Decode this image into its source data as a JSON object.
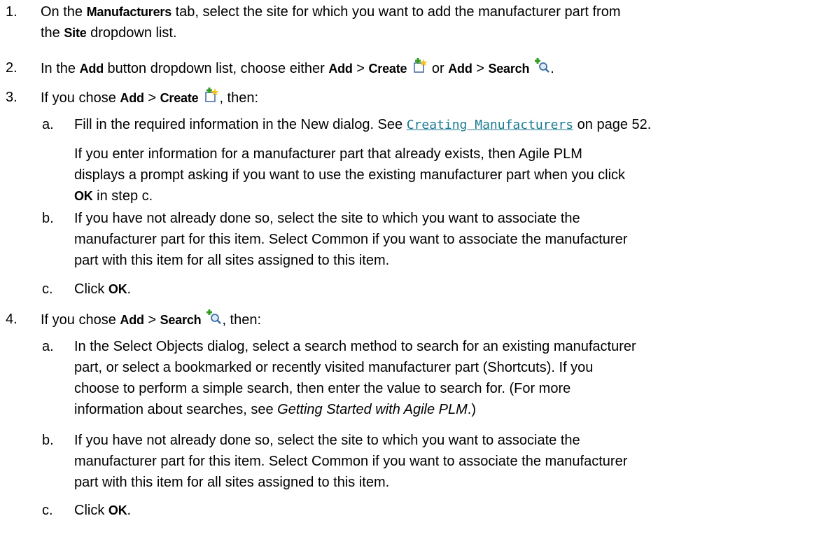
{
  "step1": {
    "num": "1.",
    "t1": "On the ",
    "manufacturers": "Manufacturers",
    "t2": " tab, select the site for which you want to add the manufacturer part from",
    "t3": "the ",
    "site": "Site",
    "t4": " dropdown list."
  },
  "step2": {
    "num": "2.",
    "t1": "In the ",
    "add": "Add",
    "t2": " button dropdown list, choose either ",
    "gt": " > ",
    "create": "Create",
    "or": " or ",
    "search": "Search",
    "end": "."
  },
  "step3": {
    "num": "3.",
    "t1": "If you chose ",
    "add": "Add",
    "gt": " > ",
    "create": "Create",
    "t2": ", then:",
    "a": {
      "letter": "a.",
      "t1": "Fill in the required information in the New dialog. See ",
      "link": "Creating Manufacturers",
      "t2": " on page 52."
    },
    "note": {
      "line1": "If you enter information for a manufacturer part that already exists, then Agile PLM",
      "line2": "displays a prompt asking if you want to use the existing manufacturer part when you click",
      "ok": "OK",
      "t3": " in step c."
    },
    "b": {
      "letter": "b.",
      "line1": "If you have not already done so, select the site to which you want to associate the",
      "line2": "manufacturer part for this item. Select Common if you want to associate the manufacturer",
      "line3": "part with this item for all sites assigned to this item."
    },
    "c": {
      "letter": "c.",
      "t1": "Click ",
      "ok": "OK",
      "t2": "."
    }
  },
  "step4": {
    "num": "4.",
    "t1": "If you chose ",
    "add": "Add",
    "gt": " > ",
    "search": "Search",
    "t2": ", then:",
    "a": {
      "letter": "a.",
      "line1": "In the Select Objects dialog, select a search method to search for an existing manufacturer",
      "line2": "part, or select a bookmarked or recently visited manufacturer part (Shortcuts). If you",
      "line3": "choose to perform a simple search, then enter the value to search for. (For more",
      "t4": "information about searches, see ",
      "ital": "Getting Started with Agile PLM",
      "t5": ".)"
    },
    "b": {
      "letter": "b.",
      "line1": "If you have not already done so, select the site to which you want to associate the",
      "line2": "manufacturer part for this item. Select Common if you want to associate the manufacturer",
      "line3": "part with this item for all sites assigned to this item."
    },
    "c": {
      "letter": "c.",
      "t1": "Click ",
      "ok": "OK",
      "t2": "."
    }
  },
  "icons": {
    "create": "add-create-icon",
    "search": "add-search-icon",
    "plus_color": "#2e9a1e",
    "doc_color": "#4a6fa5",
    "star_color": "#f2c418",
    "lens_color": "#3a6ea5"
  }
}
